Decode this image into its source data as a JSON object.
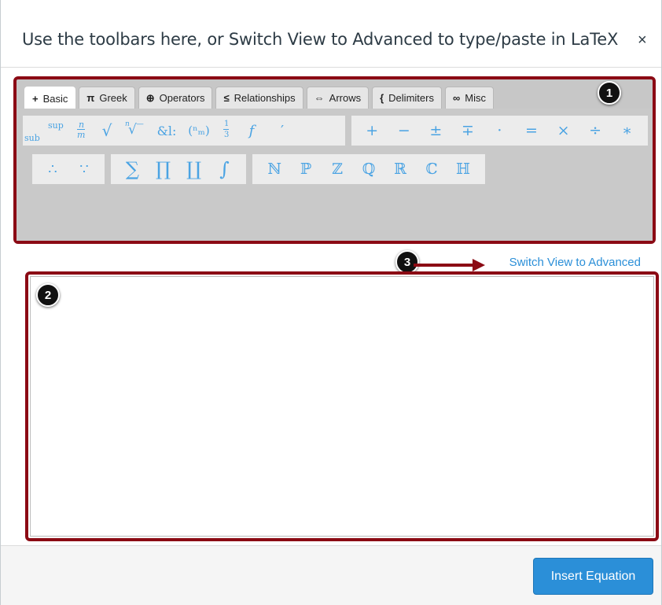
{
  "header": {
    "title": "Use the toolbars here, or Switch View to Advanced to type/paste in LaTeX",
    "close_glyph": "×"
  },
  "tabs": [
    {
      "glyph": "+",
      "label": "Basic",
      "active": true
    },
    {
      "glyph": "π",
      "label": "Greek",
      "active": false
    },
    {
      "glyph": "⊕",
      "label": "Operators",
      "active": false
    },
    {
      "glyph": "≤",
      "label": "Relationships",
      "active": false
    },
    {
      "glyph": "⇔",
      "label": "Arrows",
      "active": false
    },
    {
      "glyph": "{",
      "label": "Delimiters",
      "active": false
    },
    {
      "glyph": "∞",
      "label": "Misc",
      "active": false
    }
  ],
  "toolbar": {
    "row1_group1": {
      "sup": "sup",
      "sub": "sub",
      "frac_num": "n",
      "frac_den": "m",
      "sqrt": "√",
      "nthroot_index": "n",
      "nthroot": "√‾",
      "amp": "&l:",
      "binom": "(ⁿₘ)",
      "third_num": "1",
      "third_den": "3",
      "f": "f",
      "prime": "′"
    },
    "row1_group2": [
      "+",
      "−",
      "±",
      "∓",
      "·",
      "=",
      "×",
      "÷",
      "∗"
    ],
    "row2_group1": [
      "∴",
      "∵"
    ],
    "row2_group2": [
      "∑",
      "∏",
      "∐",
      "∫"
    ],
    "row2_group3": [
      "ℕ",
      "ℙ",
      "ℤ",
      "ℚ",
      "ℝ",
      "ℂ",
      "ℍ"
    ]
  },
  "callouts": {
    "one": "1",
    "two": "2",
    "three": "3"
  },
  "switch_view_label": "Switch View to Advanced",
  "footer": {
    "insert_label": "Insert Equation"
  },
  "colors": {
    "accent": "#2b8fd8",
    "annotation": "#8b0a14",
    "symbol": "#4aa3e3"
  }
}
